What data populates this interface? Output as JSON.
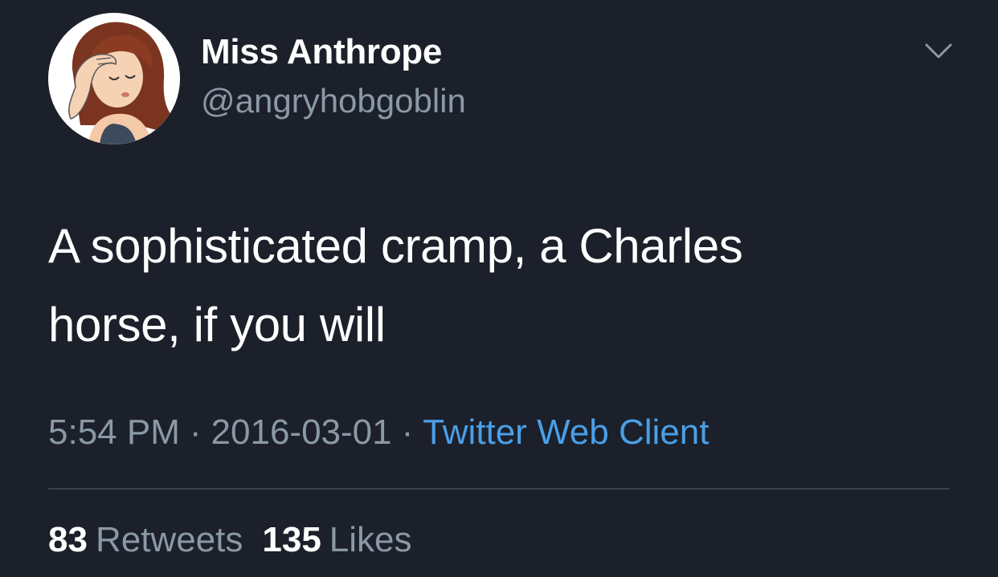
{
  "tweet": {
    "display_name": "Miss Anthrope",
    "handle": "@angryhobgoblin",
    "text_line1": "A sophisticated cramp, a Charles",
    "text_line2": "horse, if you will",
    "time": "5:54 PM",
    "dot1": "·",
    "date": "2016-03-01",
    "dot2": "·",
    "source": "Twitter Web Client",
    "retweets_count": "83",
    "retweets_label": "Retweets",
    "likes_count": "135",
    "likes_label": "Likes"
  },
  "icons": {
    "avatar": "cartoon-woman-facepalm-avatar",
    "menu": "chevron-down-icon"
  },
  "colors": {
    "background": "#1b202a",
    "text": "#ffffff",
    "muted": "#8b98a5",
    "link": "#4a9fe6",
    "divider": "#38444d"
  }
}
